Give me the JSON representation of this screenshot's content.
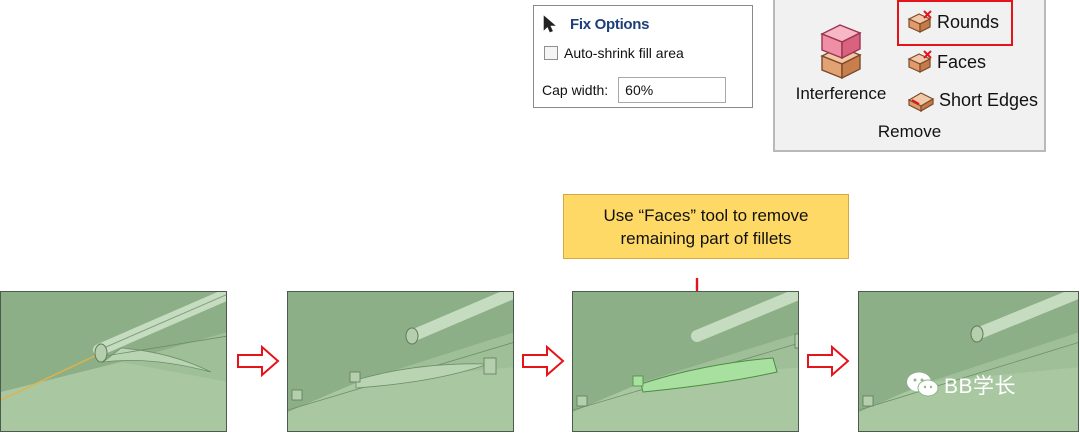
{
  "fix_options": {
    "title": "Fix Options",
    "auto_shrink_label": "Auto-shrink fill area",
    "auto_shrink_checked": false,
    "cap_width_label": "Cap width:",
    "cap_width_value": "60%"
  },
  "remove_group": {
    "interference_label": "Interference",
    "rounds_label": "Rounds",
    "faces_label": "Faces",
    "short_edges_label": "Short Edges",
    "group_label": "Remove",
    "highlight_color": "#e5141b"
  },
  "callout": {
    "line1": "Use “Faces” tool to remove",
    "line2": "remaining part of fillets"
  },
  "colors": {
    "callout_bg": "#ffd966",
    "arrow_red": "#e5141b",
    "model_green": "#8fb98a",
    "header_blue": "#1f3f7a"
  },
  "watermark": {
    "text": "BB学长"
  }
}
